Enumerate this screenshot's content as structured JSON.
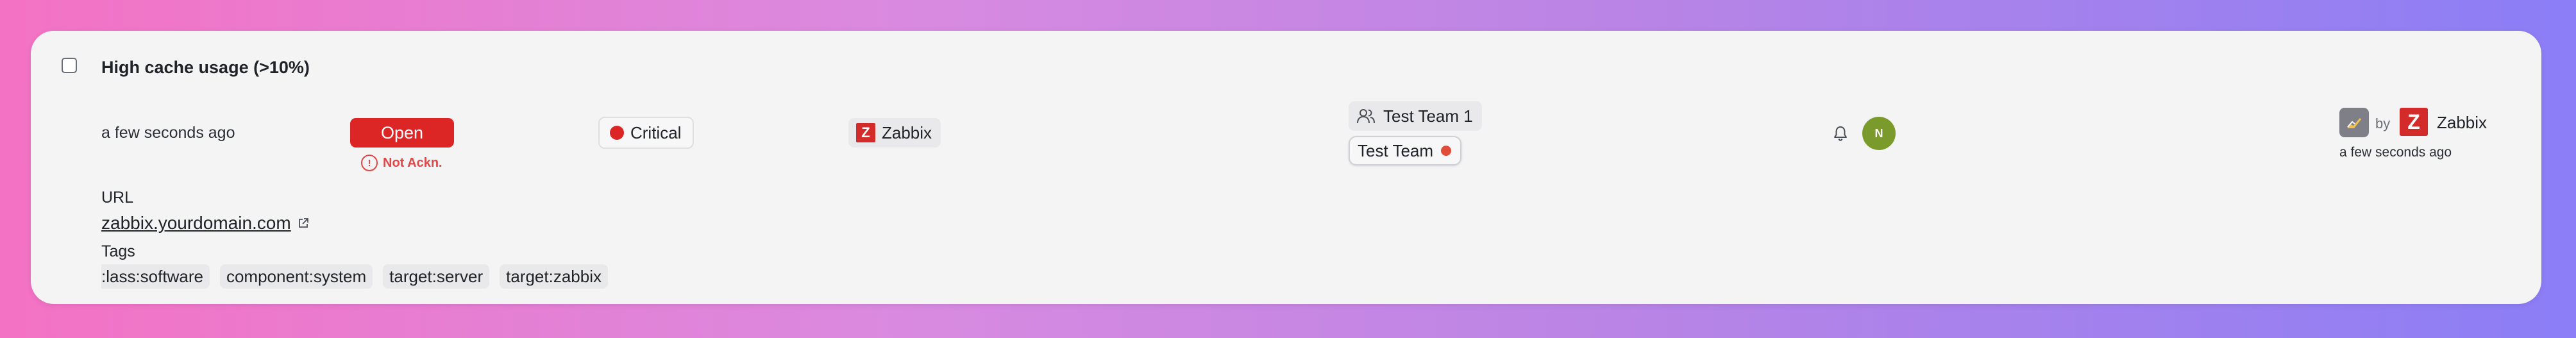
{
  "alert": {
    "title": "High cache usage (>10%)",
    "time": "a few seconds ago",
    "status": "Open",
    "ack_status": "Not Ackn.",
    "ack_icon": "!",
    "severity": "Critical",
    "integration": "Zabbix",
    "integration_logo": "Z",
    "teams": [
      "Test Team 1",
      "Test Team"
    ],
    "responder_initial": "N",
    "updated_by_prefix": "by",
    "updated_by": "Zabbix",
    "updated_time": "a few seconds ago"
  },
  "url": {
    "label": "URL",
    "value": "zabbix.yourdomain.com"
  },
  "tags": {
    "label": "Tags",
    "items": [
      ":lass:software",
      "component:system",
      "target:server",
      "target:zabbix"
    ]
  },
  "colors": {
    "critical": "#dc2626",
    "avatar": "#7a9b2c",
    "zabbix": "#d32a2a"
  }
}
